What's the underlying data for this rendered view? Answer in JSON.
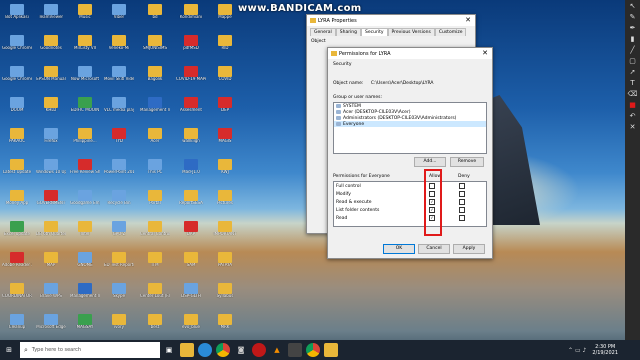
{
  "watermark": "www.BANDICAM.com",
  "desktop_icons": [
    {
      "label": "Bot Aplikasi",
      "type": "app"
    },
    {
      "label": "TeamViewer",
      "type": "app"
    },
    {
      "label": "Music",
      "type": "folder"
    },
    {
      "label": "Viber",
      "type": "app"
    },
    {
      "label": "bd",
      "type": "folder"
    },
    {
      "label": "Kondimiani",
      "type": "folder"
    },
    {
      "label": "Mappe",
      "type": "folder"
    },
    {
      "label": "Google Chrome",
      "type": "app"
    },
    {
      "label": "Goodnotes",
      "type": "folder"
    },
    {
      "label": "MirListy VII",
      "type": "folder"
    },
    {
      "label": "Veneko-Mi",
      "type": "folder"
    },
    {
      "label": "SMJUNISIMS",
      "type": "folder"
    },
    {
      "label": "pdfMSD",
      "type": "pdf"
    },
    {
      "label": "RID",
      "type": "folder"
    },
    {
      "label": "Google Chrome",
      "type": "app"
    },
    {
      "label": "EPSON Manual",
      "type": "folder"
    },
    {
      "label": "Now Microsoft",
      "type": "app"
    },
    {
      "label": "Movil Skitl Video",
      "type": "app"
    },
    {
      "label": "Bagolik",
      "type": "folder"
    },
    {
      "label": "COVID-19 MAPA",
      "type": "pdf"
    },
    {
      "label": "COVID",
      "type": "folder"
    },
    {
      "label": "DOOM",
      "type": "app"
    },
    {
      "label": "KHLU",
      "type": "folder"
    },
    {
      "label": "EDIFIC MOOIN",
      "type": "exe"
    },
    {
      "label": "VLC media player",
      "type": "app"
    },
    {
      "label": "Management Information",
      "type": "doc"
    },
    {
      "label": "Assesment",
      "type": "pdf"
    },
    {
      "label": "DEP",
      "type": "pdf"
    },
    {
      "label": "PAKAOC",
      "type": "folder"
    },
    {
      "label": "Firefox",
      "type": "app"
    },
    {
      "label": "Philippine...",
      "type": "folder"
    },
    {
      "label": "TYD",
      "type": "pdf"
    },
    {
      "label": "Acer",
      "type": "folder"
    },
    {
      "label": "wallkiign",
      "type": "folder"
    },
    {
      "label": "MAGIS",
      "type": "pdf"
    },
    {
      "label": "Latest Update",
      "type": "folder"
    },
    {
      "label": "Windows 10 Update",
      "type": "app"
    },
    {
      "label": "Free Review Shapes",
      "type": "pdf"
    },
    {
      "label": "PowerPoint 2016",
      "type": "app"
    },
    {
      "label": "This PC",
      "type": "app"
    },
    {
      "label": "Mad-J1.0",
      "type": "doc"
    },
    {
      "label": "KWJ",
      "type": "folder"
    },
    {
      "label": "Money App",
      "type": "folder"
    },
    {
      "label": "GOVERNMENT",
      "type": "pdf"
    },
    {
      "label": "Goodgame Empire",
      "type": "app"
    },
    {
      "label": "Recycle Bin",
      "type": "app"
    },
    {
      "label": "Portal",
      "type": "folder"
    },
    {
      "label": "ReportSESA",
      "type": "folder"
    },
    {
      "label": "Pictures",
      "type": "folder"
    },
    {
      "label": "Excel update",
      "type": "exe"
    },
    {
      "label": "DB 6th Quarter",
      "type": "folder"
    },
    {
      "label": "Intel",
      "type": "folder"
    },
    {
      "label": "GPU-Z",
      "type": "app"
    },
    {
      "label": "Central Control",
      "type": "folder"
    },
    {
      "label": "DAP",
      "type": "pdf"
    },
    {
      "label": "IMPORTANT",
      "type": "folder"
    },
    {
      "label": "Adobe Reader XI",
      "type": "pdf"
    },
    {
      "label": "MAP",
      "type": "folder"
    },
    {
      "label": "GNOME",
      "type": "app"
    },
    {
      "label": "ED Test Reports",
      "type": "folder"
    },
    {
      "label": "ITM",
      "type": "folder"
    },
    {
      "label": "SAM",
      "type": "folder"
    },
    {
      "label": "PATAYA",
      "type": "folder"
    },
    {
      "label": "COORDINATORS",
      "type": "folder"
    },
    {
      "label": "Brave WPS",
      "type": "app"
    },
    {
      "label": "Management Information",
      "type": "doc"
    },
    {
      "label": "Skype",
      "type": "app"
    },
    {
      "label": "Center Lout (F.E)",
      "type": "folder"
    },
    {
      "label": "DSP-GLTH",
      "type": "app"
    },
    {
      "label": "Syllabus",
      "type": "folder"
    },
    {
      "label": "Cleanup",
      "type": "app"
    },
    {
      "label": "Microsoft Edge",
      "type": "app"
    },
    {
      "label": "MAGSAY",
      "type": "exe"
    },
    {
      "label": "ivory",
      "type": "folder"
    },
    {
      "label": "best",
      "type": "folder"
    },
    {
      "label": "evo_blue",
      "type": "folder"
    },
    {
      "label": "MRK",
      "type": "folder"
    }
  ],
  "props_window": {
    "title": "LYRA Properties",
    "tabs": [
      "General",
      "Sharing",
      "Security",
      "Previous Versions",
      "Customize"
    ],
    "active_tab": "Security",
    "object_label": "Object"
  },
  "perm_dialog": {
    "title": "Permissions for LYRA",
    "security_tab": "Security",
    "object_name_label": "Object name:",
    "object_name": "C:\\Users\\Acer\\Desktop\\LYRA",
    "group_label": "Group or user names:",
    "users": [
      "SYSTEM",
      "Acer (DESKTOP-CILE03V\\Acer)",
      "Administrators (DESKTOP-CILE03V\\Administrators)",
      "Everyone"
    ],
    "selected_user": "Everyone",
    "add_button": "Add...",
    "remove_button": "Remove",
    "permissions_for": "Permissions for Everyone",
    "allow_header": "Allow",
    "deny_header": "Deny",
    "permissions": [
      {
        "name": "Full control",
        "allow": false,
        "deny": false
      },
      {
        "name": "Modify",
        "allow": false,
        "deny": false
      },
      {
        "name": "Read & execute",
        "allow": true,
        "deny": false
      },
      {
        "name": "List folder contents",
        "allow": true,
        "deny": false
      },
      {
        "name": "Read",
        "allow": true,
        "deny": false
      }
    ],
    "ok_button": "OK",
    "cancel_button": "Cancel",
    "apply_button": "Apply",
    "highlight_color": "#e01a1a"
  },
  "taskbar": {
    "search_placeholder": "Type here to search",
    "time": "2:30 PM",
    "date": "2/19/2021"
  },
  "toolstrip_icons": [
    "pointer-icon",
    "pencil-icon",
    "pen-icon",
    "marker-icon",
    "line-icon",
    "rectangle-icon",
    "arrow-icon",
    "text-icon",
    "eraser-icon",
    "color-swatch-icon",
    "undo-icon",
    "clear-icon"
  ]
}
